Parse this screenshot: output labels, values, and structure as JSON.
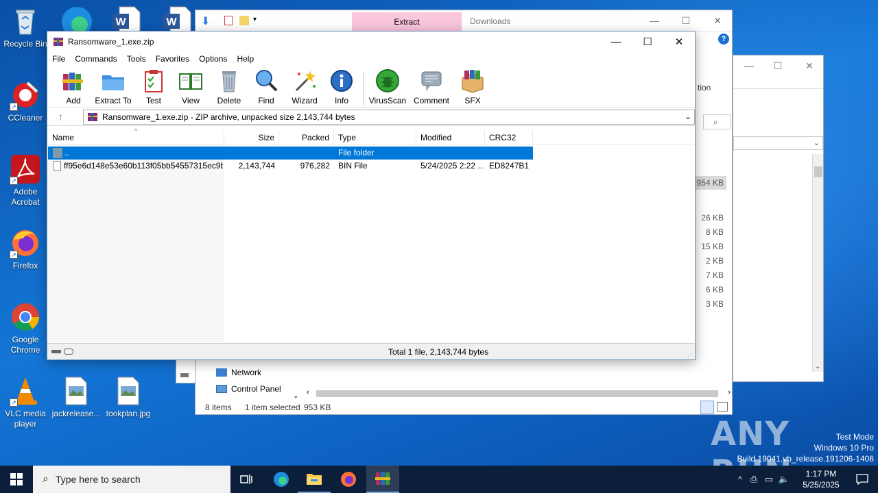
{
  "desktop": {
    "icons": [
      {
        "label": "Recycle Bin"
      },
      {
        "label": "CCleaner"
      },
      {
        "label": "Adobe Acrobat"
      },
      {
        "label": "Firefox"
      },
      {
        "label": "Google Chrome"
      },
      {
        "label": "VLC media player"
      },
      {
        "label": "jackrelease..."
      },
      {
        "label": "tookplan.jpg"
      }
    ],
    "watermark": {
      "brand": "ANY RUN",
      "line1": "Test Mode",
      "line2": "Windows 10 Pro",
      "line3": "Build 19041.vb_release.191206-1406"
    }
  },
  "explorer": {
    "ribbon_tab_extract": "Extract",
    "ribbon_tab_downloads": "Downloads",
    "ribbon_partial": "tion",
    "nav_items": [
      "Network",
      "Control Panel"
    ],
    "status_items": "8 items",
    "status_selected": "1 item selected",
    "status_size": "953 KB",
    "sizes": [
      "954 KB",
      "26 KB",
      "8 KB",
      "15 KB",
      "2 KB",
      "7 KB",
      "6 KB",
      "3 KB"
    ]
  },
  "winrar": {
    "title": "Ransomware_1.exe.zip",
    "menu": [
      "File",
      "Commands",
      "Tools",
      "Favorites",
      "Options",
      "Help"
    ],
    "toolbar": [
      "Add",
      "Extract To",
      "Test",
      "View",
      "Delete",
      "Find",
      "Wizard",
      "Info",
      "VirusScan",
      "Comment",
      "SFX"
    ],
    "address": "Ransomware_1.exe.zip - ZIP archive, unpacked size 2,143,744 bytes",
    "columns": [
      "Name",
      "Size",
      "Packed",
      "Type",
      "Modified",
      "CRC32"
    ],
    "rows": [
      {
        "name": "..",
        "size": "",
        "packed": "",
        "type": "File folder",
        "modified": "",
        "crc": ""
      },
      {
        "name": "ff95e6d148e53e60b113f05bb54557315ec9b...",
        "size": "2,143,744",
        "packed": "976,282",
        "type": "BIN File",
        "modified": "5/24/2025 2:22 ...",
        "crc": "ED8247B1"
      }
    ],
    "status": "Total 1 file, 2,143,744 bytes"
  },
  "taskbar": {
    "search_placeholder": "Type here to search",
    "time": "1:17 PM",
    "date": "5/25/2025"
  }
}
